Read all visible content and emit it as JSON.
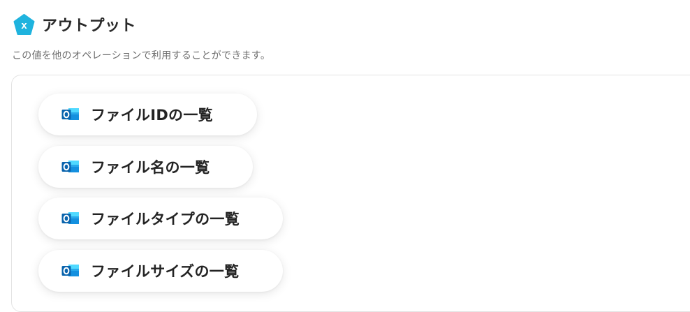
{
  "header": {
    "badge_letter": "x",
    "badge_color": "#1fb3de",
    "title": "アウトプット",
    "description": "この値を他のオペレーションで利用することができます。"
  },
  "outputs": {
    "icon": "outlook-icon",
    "items": [
      {
        "label": "ファイルIDの一覧"
      },
      {
        "label": "ファイル名の一覧"
      },
      {
        "label": "ファイルタイプの一覧"
      },
      {
        "label": "ファイルサイズの一覧"
      }
    ]
  }
}
